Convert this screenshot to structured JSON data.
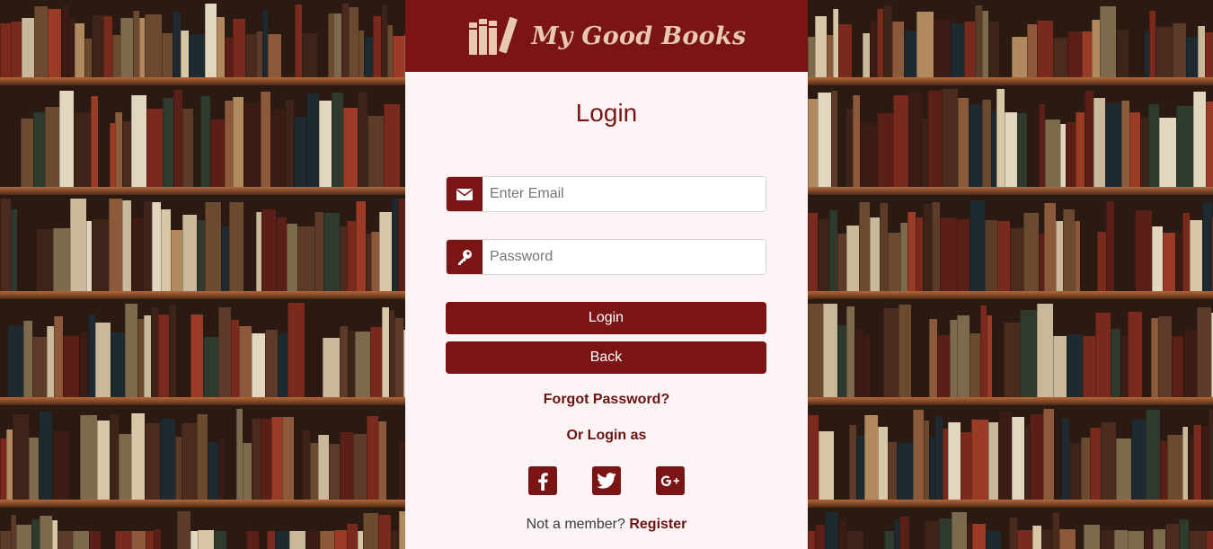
{
  "brand": {
    "name": "My Good Books",
    "logo_icon": "books-icon"
  },
  "login": {
    "title": "Login",
    "email_placeholder": "Enter Email",
    "email_icon": "envelope-icon",
    "password_placeholder": "Password",
    "password_icon": "key-icon",
    "login_button": "Login",
    "back_button": "Back",
    "forgot_password": "Forgot Password?",
    "or_login_as": "Or Login as",
    "socials": [
      {
        "name": "facebook",
        "icon": "facebook-icon"
      },
      {
        "name": "twitter",
        "icon": "twitter-icon"
      },
      {
        "name": "google-plus",
        "icon": "google-plus-icon"
      }
    ],
    "not_member": "Not a member?",
    "register": "Register"
  },
  "colors": {
    "brand": "#7b1515",
    "panel_bg": "#fcf4f4",
    "logo_text": "#e8c9b0"
  }
}
